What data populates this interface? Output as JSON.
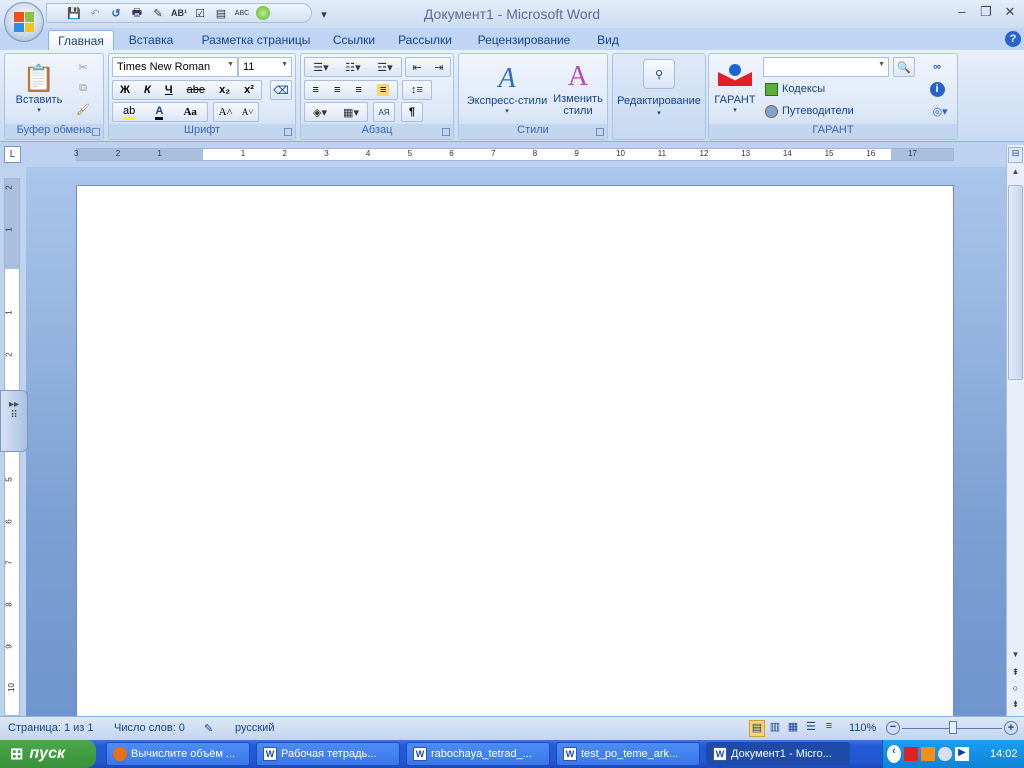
{
  "window": {
    "title": "Документ1 - Microsoft Word"
  },
  "quick_access": [
    "save-icon",
    "undo-icon",
    "redo-icon",
    "print-icon",
    "edit-icon",
    "spelling-icon",
    "track-changes-icon",
    "document-icon",
    "abc-123-icon",
    "green-circle-icon"
  ],
  "tabs": [
    {
      "label": "Главная",
      "active": true
    },
    {
      "label": "Вставка"
    },
    {
      "label": "Разметка страницы"
    },
    {
      "label": "Ссылки"
    },
    {
      "label": "Рассылки"
    },
    {
      "label": "Рецензирование"
    },
    {
      "label": "Вид"
    }
  ],
  "ribbon": {
    "clipboard": {
      "label": "Буфер обмена",
      "paste": "Вставить"
    },
    "font": {
      "label": "Шрифт",
      "font_name": "Times New Roman",
      "font_size": "11",
      "bold": "Ж",
      "italic": "К",
      "underline": "Ч",
      "strike": "abe",
      "subscript": "x₂",
      "superscript": "x²",
      "change_case": "Aa",
      "grow": "A˄",
      "shrink": "A˅",
      "highlight": "ab",
      "font_color": "A",
      "highlight_color": "#ffff00",
      "font_color_value": "#000000"
    },
    "paragraph": {
      "label": "Абзац",
      "pilcrow": "¶",
      "sort": "АЯ"
    },
    "styles": {
      "label": "Стили",
      "express": "Экспресс-стили",
      "change_line1": "Изменить",
      "change_line2": "стили"
    },
    "editing": {
      "label": "Редактирование"
    },
    "garant": {
      "label": "ГАРАНТ",
      "button": "ГАРАНТ",
      "search_value": "",
      "codes": "Кодексы",
      "guides": "Путеводители"
    }
  },
  "ruler": {
    "h_ticks": [
      "3",
      "2",
      "1",
      "",
      "1",
      "2",
      "3",
      "4",
      "5",
      "6",
      "7",
      "8",
      "9",
      "10",
      "11",
      "12",
      "13",
      "14",
      "15",
      "16",
      "17"
    ],
    "v_ticks": [
      "2",
      "1",
      "",
      "1",
      "2",
      "3",
      "4",
      "5",
      "6",
      "7",
      "8",
      "9",
      "10"
    ]
  },
  "status": {
    "page": "Страница: 1 из 1",
    "words": "Число слов: 0",
    "language": "русский",
    "zoom": "110%",
    "zoom_percent": 110
  },
  "taskbar": {
    "start": "пуск",
    "tasks": [
      {
        "label": "Вычислите объём ...",
        "icon": "firefox-icon"
      },
      {
        "label": "Рабочая тетрадь...",
        "icon": "word-icon"
      },
      {
        "label": "rabochaya_tetrad_...",
        "icon": "word-icon"
      },
      {
        "label": "test_po_teme_ark...",
        "icon": "word-icon"
      },
      {
        "label": "Документ1 - Micro...",
        "icon": "word-icon",
        "active": true
      }
    ],
    "clock": "14:02"
  },
  "colors": {
    "accent": "#15428b",
    "ribbon": "#dbe6f5",
    "taskbar": "#245bd8",
    "start": "#3a913a"
  }
}
